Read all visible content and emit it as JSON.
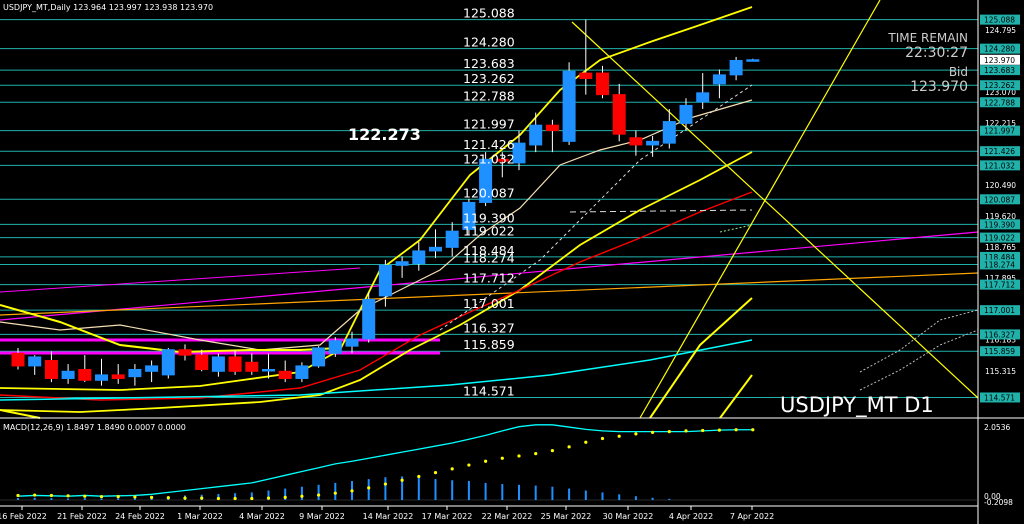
{
  "header": {
    "text": "USDJPY_MT,Daily  123.964 123.997 123.938 123.970"
  },
  "info_panel": {
    "time_remain_label": "TIME REMAIN",
    "time_remain_value": "22:30:27",
    "bid_label": "Bid",
    "bid_value": "123.970"
  },
  "watermark": "USDJPY_MT D1",
  "annotation_price": "122.273",
  "macd_header": "MACD(12,26,9) 1.8497 1.8490 0.0007 0.0000",
  "colors": {
    "background": "#000000",
    "bull_candle": "#1e90ff",
    "bear_candle": "#ff0000",
    "level_line": "#20b2aa",
    "axis_label_bg": "#20b2aa",
    "bollinger": "#ffff00",
    "magenta_line": "#ff00ff",
    "orange_line": "#ffa500",
    "red_ma": "#ff0000",
    "macd_line": "#00ffff",
    "macd_signal": "#ffff00",
    "macd_hist": "#1e90ff"
  },
  "chart_data": {
    "type": "candlestick",
    "symbol": "USDJPY_MT",
    "timeframe": "D1",
    "ylim": [
      114.0,
      125.3
    ],
    "x_ticks": [
      "16 Feb 2022",
      "21 Feb 2022",
      "24 Feb 2022",
      "1 Mar 2022",
      "4 Mar 2022",
      "9 Mar 2022",
      "14 Mar 2022",
      "17 Mar 2022",
      "22 Mar 2022",
      "25 Mar 2022",
      "30 Mar 2022",
      "4 Apr 2022",
      "7 Apr 2022"
    ],
    "price_levels": [
      125.088,
      124.28,
      123.683,
      123.262,
      122.788,
      121.997,
      121.426,
      121.032,
      120.087,
      119.39,
      119.022,
      118.484,
      118.274,
      117.712,
      117.001,
      116.327,
      115.859,
      114.571
    ],
    "level_labels_text": [
      "125.088",
      "124.280",
      "123.683",
      "123.262",
      "122.788",
      "121.997",
      "121.426",
      "121.032",
      "120.087",
      "119.390",
      "119.022",
      "118.484",
      "118.274",
      "117.712",
      "117.001",
      "116.327",
      "115.859",
      "114.571"
    ],
    "axis_plain_ticks": [
      "124.795",
      "123.070",
      "122.215",
      "120.490",
      "119.620",
      "118.765",
      "117.895",
      "116.183",
      "115.315"
    ],
    "axis_highlight_ticks": [
      "125.088",
      "124.280",
      "123.970",
      "123.683",
      "123.262",
      "122.788",
      "121.997",
      "121.426",
      "121.032",
      "120.087",
      "119.390",
      "119.022",
      "118.484",
      "118.274",
      "117.712",
      "117.001",
      "116.327",
      "115.859",
      "114.571"
    ],
    "candles": [
      {
        "o": 115.8,
        "h": 115.95,
        "l": 115.35,
        "c": 115.45
      },
      {
        "o": 115.45,
        "h": 115.75,
        "l": 115.2,
        "c": 115.7
      },
      {
        "o": 115.6,
        "h": 115.85,
        "l": 115.0,
        "c": 115.1
      },
      {
        "o": 115.1,
        "h": 115.5,
        "l": 114.95,
        "c": 115.3
      },
      {
        "o": 115.35,
        "h": 115.75,
        "l": 115.0,
        "c": 115.05
      },
      {
        "o": 115.05,
        "h": 115.65,
        "l": 114.9,
        "c": 115.2
      },
      {
        "o": 115.2,
        "h": 115.5,
        "l": 114.95,
        "c": 115.1
      },
      {
        "o": 115.15,
        "h": 115.5,
        "l": 114.9,
        "c": 115.35
      },
      {
        "o": 115.3,
        "h": 115.6,
        "l": 115.0,
        "c": 115.45
      },
      {
        "o": 115.2,
        "h": 115.95,
        "l": 115.1,
        "c": 115.9
      },
      {
        "o": 115.9,
        "h": 116.05,
        "l": 115.6,
        "c": 115.75
      },
      {
        "o": 115.75,
        "h": 115.9,
        "l": 115.3,
        "c": 115.35
      },
      {
        "o": 115.3,
        "h": 115.8,
        "l": 115.15,
        "c": 115.7
      },
      {
        "o": 115.7,
        "h": 115.9,
        "l": 115.2,
        "c": 115.3
      },
      {
        "o": 115.55,
        "h": 115.8,
        "l": 115.2,
        "c": 115.3
      },
      {
        "o": 115.35,
        "h": 115.8,
        "l": 115.1,
        "c": 115.35
      },
      {
        "o": 115.3,
        "h": 115.6,
        "l": 115.0,
        "c": 115.1
      },
      {
        "o": 115.1,
        "h": 115.55,
        "l": 115.0,
        "c": 115.45
      },
      {
        "o": 115.45,
        "h": 116.0,
        "l": 115.4,
        "c": 115.95
      },
      {
        "o": 115.8,
        "h": 116.25,
        "l": 115.7,
        "c": 116.15
      },
      {
        "o": 116.0,
        "h": 116.4,
        "l": 115.8,
        "c": 116.2
      },
      {
        "o": 116.2,
        "h": 117.5,
        "l": 116.1,
        "c": 117.3
      },
      {
        "o": 117.4,
        "h": 118.4,
        "l": 117.1,
        "c": 118.25
      },
      {
        "o": 118.25,
        "h": 118.5,
        "l": 117.9,
        "c": 118.35
      },
      {
        "o": 118.3,
        "h": 118.9,
        "l": 118.1,
        "c": 118.65
      },
      {
        "o": 118.65,
        "h": 119.25,
        "l": 118.45,
        "c": 118.75
      },
      {
        "o": 118.75,
        "h": 119.45,
        "l": 118.5,
        "c": 119.2
      },
      {
        "o": 119.25,
        "h": 120.1,
        "l": 119.1,
        "c": 120.0
      },
      {
        "o": 120.0,
        "h": 121.4,
        "l": 119.9,
        "c": 121.2
      },
      {
        "o": 121.2,
        "h": 121.4,
        "l": 120.7,
        "c": 121.15
      },
      {
        "o": 121.1,
        "h": 122.0,
        "l": 120.9,
        "c": 121.65
      },
      {
        "o": 121.6,
        "h": 122.5,
        "l": 121.4,
        "c": 122.15
      },
      {
        "o": 122.15,
        "h": 122.3,
        "l": 121.4,
        "c": 122.0
      },
      {
        "o": 121.7,
        "h": 123.9,
        "l": 121.6,
        "c": 123.65
      },
      {
        "o": 123.6,
        "h": 125.09,
        "l": 123.0,
        "c": 123.45
      },
      {
        "o": 123.6,
        "h": 123.8,
        "l": 122.9,
        "c": 123.0
      },
      {
        "o": 123.0,
        "h": 123.3,
        "l": 121.7,
        "c": 121.9
      },
      {
        "o": 121.8,
        "h": 122.0,
        "l": 121.3,
        "c": 121.6
      },
      {
        "o": 121.6,
        "h": 121.85,
        "l": 121.27,
        "c": 121.7
      },
      {
        "o": 121.65,
        "h": 122.6,
        "l": 121.5,
        "c": 122.25
      },
      {
        "o": 122.2,
        "h": 122.9,
        "l": 122.0,
        "c": 122.7
      },
      {
        "o": 122.8,
        "h": 123.6,
        "l": 122.6,
        "c": 123.05
      },
      {
        "o": 123.3,
        "h": 123.7,
        "l": 122.9,
        "c": 123.55
      },
      {
        "o": 123.55,
        "h": 124.05,
        "l": 123.4,
        "c": 123.95
      },
      {
        "o": 123.96,
        "h": 124.0,
        "l": 123.94,
        "c": 123.97
      }
    ],
    "macd": {
      "ylim": [
        0.0,
        2.0536
      ],
      "axis_top": "2.0536",
      "axis_zero": "0.00",
      "axis_bottom": "-0.2098",
      "macd_line": [
        0.1,
        0.12,
        0.11,
        0.1,
        0.12,
        0.1,
        0.11,
        0.12,
        0.15,
        0.2,
        0.25,
        0.3,
        0.35,
        0.4,
        0.45,
        0.55,
        0.65,
        0.75,
        0.85,
        0.95,
        1.02,
        1.1,
        1.18,
        1.26,
        1.34,
        1.42,
        1.5,
        1.6,
        1.7,
        1.82,
        1.93,
        1.98,
        1.98,
        1.92,
        1.86,
        1.82,
        1.8,
        1.8,
        1.8,
        1.8,
        1.8,
        1.82,
        1.84,
        1.85,
        1.85
      ],
      "signal_dots": [
        0.12,
        0.13,
        0.12,
        0.11,
        0.1,
        0.09,
        0.09,
        0.08,
        0.07,
        0.06,
        0.05,
        0.05,
        0.04,
        0.04,
        0.04,
        0.05,
        0.07,
        0.1,
        0.13,
        0.18,
        0.24,
        0.32,
        0.42,
        0.52,
        0.62,
        0.72,
        0.82,
        0.92,
        1.02,
        1.1,
        1.16,
        1.22,
        1.3,
        1.4,
        1.52,
        1.62,
        1.68,
        1.74,
        1.78,
        1.8,
        1.82,
        1.83,
        1.84,
        1.85,
        1.85
      ],
      "histogram": [
        0.05,
        0.06,
        0.05,
        0.04,
        0.05,
        0.04,
        0.05,
        0.05,
        0.07,
        0.1,
        0.12,
        0.14,
        0.16,
        0.18,
        0.2,
        0.25,
        0.3,
        0.35,
        0.4,
        0.45,
        0.5,
        0.55,
        0.6,
        0.62,
        0.6,
        0.55,
        0.52,
        0.5,
        0.45,
        0.42,
        0.4,
        0.38,
        0.35,
        0.3,
        0.25,
        0.2,
        0.15,
        0.1,
        0.06,
        0.03,
        0.0,
        0.0,
        0.0,
        0.0,
        0.0
      ]
    }
  }
}
